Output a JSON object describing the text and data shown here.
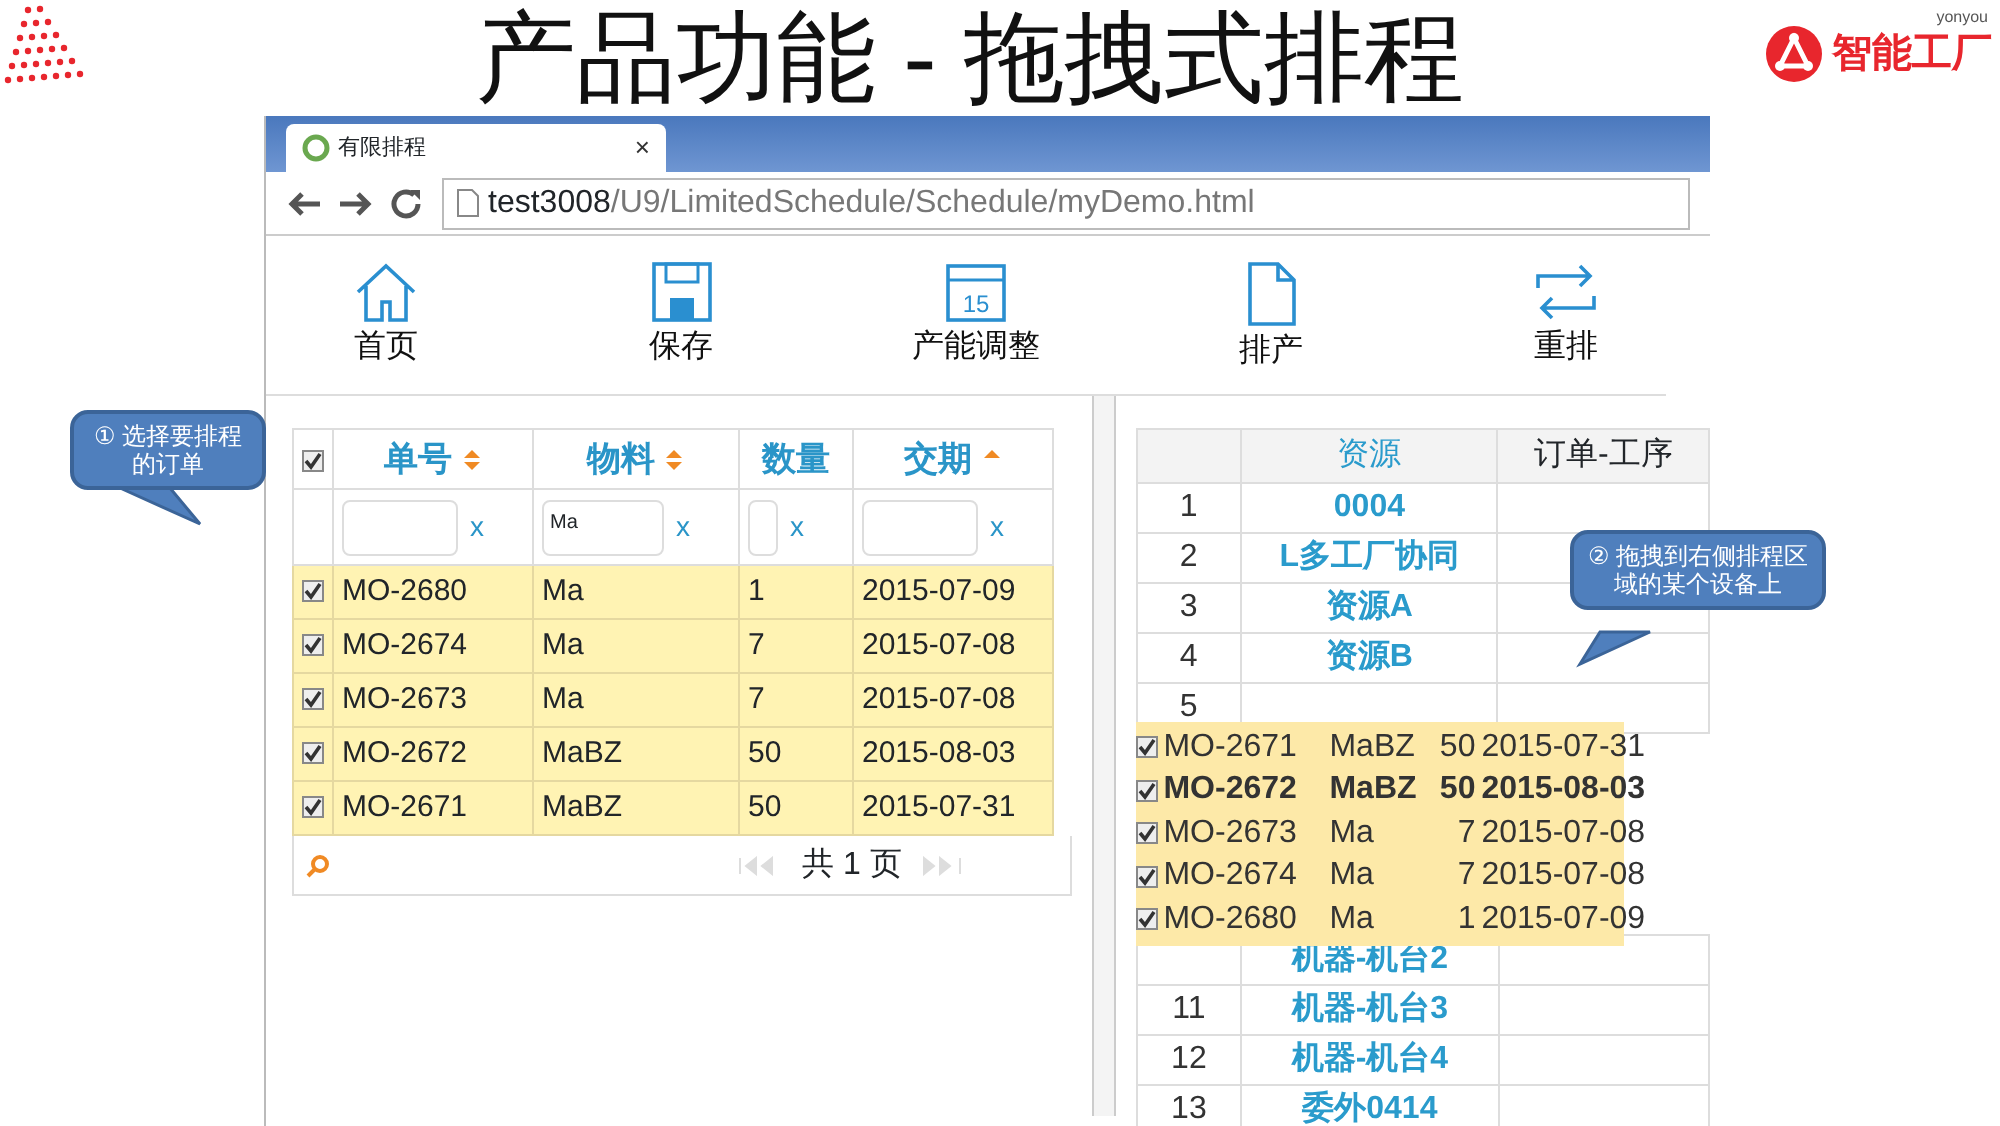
{
  "slide": {
    "title": "产品功能 - 拖拽式排程",
    "logo": {
      "brand": "yonyou",
      "text": "智能工厂"
    }
  },
  "browser": {
    "tab": {
      "title": "有限排程",
      "close": "×"
    },
    "address": {
      "host": "test3008",
      "path": "/U9/LimitedSchedule/Schedule/myDemo.html"
    }
  },
  "toolbar": [
    {
      "kind": "home",
      "label": "首页"
    },
    {
      "kind": "save",
      "label": "保存"
    },
    {
      "kind": "calendar",
      "icon_text": "15",
      "label": "产能调整"
    },
    {
      "kind": "document",
      "label": "排产"
    },
    {
      "kind": "repeat",
      "label": "重排"
    }
  ],
  "orders_grid": {
    "select_all": {
      "checked": true
    },
    "columns": [
      {
        "label": "单号",
        "sortable": true,
        "sorted": false
      },
      {
        "label": "物料",
        "sortable": true,
        "sorted": false
      },
      {
        "label": "数量",
        "sortable": false
      },
      {
        "label": "交期",
        "sortable": true,
        "sorted": true
      }
    ],
    "filters": [
      {
        "clear": "x"
      },
      {
        "value": "Ma",
        "clear": "x"
      },
      {
        "clear": "x"
      },
      {
        "clear": "x"
      }
    ],
    "rows": [
      {
        "checked": true,
        "cells": [
          "MO-2680",
          "Ma",
          "1",
          "2015-07-09"
        ]
      },
      {
        "checked": true,
        "cells": [
          "MO-2674",
          "Ma",
          "7",
          "2015-07-08"
        ]
      },
      {
        "checked": true,
        "cells": [
          "MO-2673",
          "Ma",
          "7",
          "2015-07-08"
        ]
      },
      {
        "checked": true,
        "cells": [
          "MO-2672",
          "MaBZ",
          "50",
          "2015-08-03"
        ]
      },
      {
        "checked": true,
        "cells": [
          "MO-2671",
          "MaBZ",
          "50",
          "2015-07-31"
        ]
      }
    ],
    "pager": {
      "text": "共 1 页"
    }
  },
  "resource_table": {
    "columns": [
      {
        "label": "资源"
      },
      {
        "label": "订单-工序"
      }
    ],
    "rows_above": [
      {
        "number": "1",
        "resource": "0004"
      },
      {
        "number": "2",
        "resource": "L多工厂协同"
      },
      {
        "number": "3",
        "resource": "资源A"
      },
      {
        "number": "4",
        "resource": "资源B"
      },
      {
        "number": "5"
      }
    ],
    "drag_preview": [
      {
        "checked": true,
        "bold": false,
        "cells": [
          "MO-2671",
          "MaBZ",
          "50",
          "2015-07-31"
        ]
      },
      {
        "checked": true,
        "bold": true,
        "cells": [
          "MO-2672",
          "MaBZ",
          "50",
          "2015-08-03"
        ]
      },
      {
        "checked": true,
        "bold": false,
        "cells": [
          "MO-2673",
          "Ma",
          "7",
          "2015-07-08"
        ]
      },
      {
        "checked": true,
        "bold": false,
        "cells": [
          "MO-2674",
          "Ma",
          "7",
          "2015-07-08"
        ]
      },
      {
        "checked": true,
        "bold": false,
        "cells": [
          "MO-2680",
          "Ma",
          "1",
          "2015-07-09"
        ]
      }
    ],
    "rows_below": [
      {
        "resource": "机器-机台2"
      },
      {
        "number": "11",
        "resource": "机器-机台3"
      },
      {
        "number": "12",
        "resource": "机器-机台4"
      },
      {
        "number": "13",
        "resource": "委外0414"
      }
    ]
  },
  "callouts": [
    {
      "text": "① 选择要排程的订单"
    },
    {
      "text": "② 拖拽到右侧排程区域的某个设备上"
    }
  ]
}
